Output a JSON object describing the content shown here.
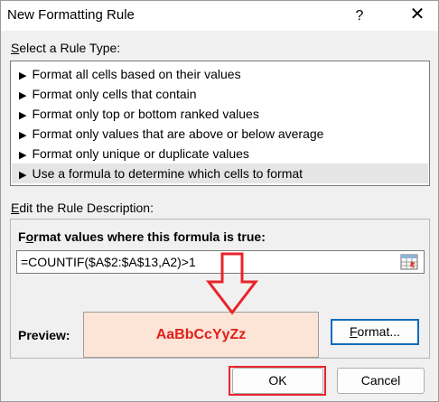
{
  "window": {
    "title": "New Formatting Rule",
    "help_glyph": "?",
    "close_glyph": "✕"
  },
  "rule_type": {
    "label_accesskey": "S",
    "label_rest": "elect a Rule Type:",
    "items": [
      {
        "label": "Format all cells based on their values",
        "selected": false
      },
      {
        "label": "Format only cells that contain",
        "selected": false
      },
      {
        "label": "Format only top or bottom ranked values",
        "selected": false
      },
      {
        "label": "Format only values that are above or below average",
        "selected": false
      },
      {
        "label": "Format only unique or duplicate values",
        "selected": false
      },
      {
        "label": "Use a formula to determine which cells to format",
        "selected": true
      }
    ]
  },
  "description": {
    "label_accesskey": "E",
    "label_rest": "dit the Rule Description:",
    "formula_heading_pre": "F",
    "formula_heading_accesskey": "o",
    "formula_heading_rest": "rmat values where this formula is true:",
    "formula_value": "=COUNTIF($A$2:$A$13,A2)>1",
    "preview_label": "Preview:",
    "preview_sample": "AaBbCcYyZz",
    "format_button_accesskey": "F",
    "format_button_rest": "ormat..."
  },
  "buttons": {
    "ok": "OK",
    "cancel": "Cancel"
  },
  "colors": {
    "annotation": "#e8252b",
    "preview_fill": "#fce4d6",
    "preview_text": "#e0201b",
    "selection": "#e5e5e5"
  }
}
